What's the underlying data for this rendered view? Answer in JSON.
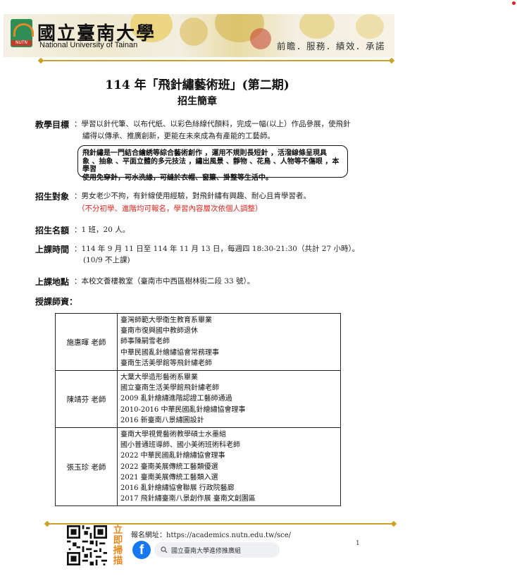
{
  "header": {
    "university_cn": "國立臺南大學",
    "university_en": "National University of Tainan",
    "logo_tag": "NUTN",
    "motto": "前瞻．服務．績效．承諾"
  },
  "title": "114 年「飛針繡藝術班」(第二期)",
  "subtitle": "招生簡章",
  "sections": {
    "goal_label": "教學目標",
    "goal_text_1": "：學習以針代筆、以布代紙、以彩色絲線代顏料，完成一幅(以上）作品參展，使飛針",
    "goal_text_2": "繡得以傳承、推廣創新，更能在未來成為有產能的工藝師。",
    "note_lines": [
      "飛針繡是一門結合繪綉等綜合藝術創作 ，運用不規則長短針 ，活潑線條呈現具",
      "象 、抽象 、平面立體的多元技法 ，繡出風景 、靜物 、花鳥 、人物等不傷眼 ，本學習",
      "使用免穿針，可水洗緣，可縫於衣帽、窗簾、掛整等生活中。"
    ],
    "target_label": "招生對象",
    "target_text": "：男女老少不拘，有針線使用經驗，對飛針繡有興趣、耐心且肯學習者。",
    "target_note": "（不分初學、進階均可報名，學習內容層次依個人調整）",
    "quota_label": "招生名額",
    "quota_text": "：1 班，20 人。",
    "time_label": "上課時間",
    "time_text": "：114 年 9 月 11 日至 114 年 11 月 13 日，每週四 18:30-21:30（共計 27 小時）。",
    "time_note": "(10/9 不上課)",
    "place_label": "上課地點",
    "place_text": "：本校文薈樓教室（臺南市中西區樹林街二段 33 號）。",
    "teachers_label": "授課師資："
  },
  "teachers": [
    {
      "name": "施惠暉 老師",
      "credentials": [
        "臺灣師範大學衛生教育系畢業",
        "臺南市復興國中教師退休",
        "師事陳嗣雪老師",
        "中華民國亂針繪繡協會常務理事",
        "臺南生活美學館等飛針繡老師"
      ]
    },
    {
      "name": "陳靖芬 老師",
      "credentials": [
        "大葉大學造形藝術系畢業",
        "國立臺南生活美學館飛針繡老師",
        "2009 亂針繪繡進階認證工藝師通過",
        "2010-2016 中華民國亂針繪繡協會理事",
        "2016 新臺南八景繡圖設計"
      ]
    },
    {
      "name": "張玉珍 老師",
      "credentials": [
        "臺南大學視覺藝術教學碩士水墨組",
        "國小普通班導師、國小美術班術科老師",
        "2022 中華民國亂針繪繡協會理事",
        "2022 臺南美展傳統工藝類優選",
        "2021 臺南美展傳統工藝類入選",
        "2016 亂針繪繡協會聯展 行政院藝廊",
        "2017 飛針繡臺南八景創作展 臺南文創園區"
      ]
    }
  ],
  "footer": {
    "scan_text": "立即掃描",
    "register": "報名網址：https://academics.nutn.edu.tw/sce/",
    "fb_search": "國立臺南大學進修推廣組",
    "page_number": "1"
  },
  "colors": {
    "gold": "#c9a227",
    "red": "#d8251d",
    "facebook": "#1877f2",
    "scan_orange": "#e6891e"
  }
}
